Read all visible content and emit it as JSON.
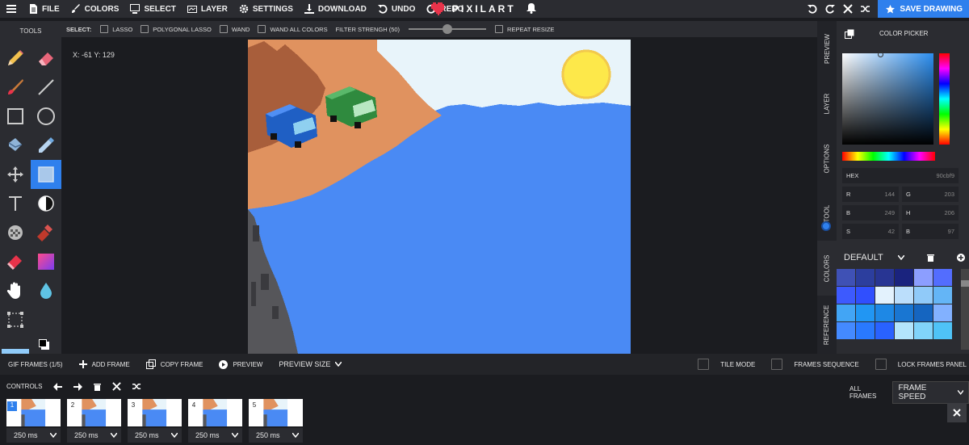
{
  "topbar": {
    "file": "FILE",
    "colors": "COLORS",
    "select": "SELECT",
    "layer": "LAYER",
    "settings": "SETTINGS",
    "download": "DOWNLOAD",
    "undo": "UNDO",
    "redo": "REDO",
    "logo_text": "PIXILART",
    "save": "SAVE DRAWING"
  },
  "tools_title": "TOOLS",
  "selection": {
    "label": "SELECT:",
    "lasso": "LASSO",
    "polygonal_lasso": "POLYGONAL LASSO",
    "wand": "WAND",
    "wand_all_colors": "WAND ALL COLORS",
    "filter_strength": "FILTER STRENGH (50)",
    "filter_value": 50,
    "repeat_resize": "REPEAT RESIZE"
  },
  "coords": "X: -61 Y: 129",
  "side_tabs": [
    "PREVIEW",
    "LAYER",
    "OPTIONS",
    "TOOL",
    "COLORS",
    "REFERENCE"
  ],
  "color_picker": {
    "title": "COLOR PICKER",
    "hex_label": "HEX",
    "hex": "90cbf9",
    "r_label": "R",
    "r": "144",
    "g_label": "G",
    "g": "203",
    "b_label": "B",
    "b": "249",
    "h_label": "H",
    "h": "206",
    "s_label": "S",
    "s": "42",
    "b2_label": "B",
    "b2": "97"
  },
  "palette": {
    "name": "DEFAULT",
    "colors": [
      "#3f51b5",
      "#2c3e9e",
      "#283593",
      "#1a237e",
      "#8c9eff",
      "#536dfe",
      "#3d5afe",
      "#304ffe",
      "#e3f2fd",
      "#bbdefb",
      "#90caf9",
      "#64b5f6",
      "#42a5f5",
      "#2196f3",
      "#1e88e5",
      "#1976d2",
      "#1565c0",
      "#82b1ff",
      "#448aff",
      "#2979ff",
      "#2962ff",
      "#b3e5fc",
      "#81d4fa",
      "#4fc3f7"
    ]
  },
  "frames_bar": {
    "gif_frames": "GIF FRAMES (1/5)",
    "add_frame": "ADD FRAME",
    "copy_frame": "COPY FRAME",
    "preview": "PREVIEW",
    "preview_size": "PREVIEW SIZE",
    "tile_mode": "TILE MODE",
    "frames_sequence": "FRAMES SEQUENCE",
    "lock_frames_panel": "LOCK FRAMES PANEL"
  },
  "controls": {
    "label": "CONTROLS",
    "all_frames": "ALL FRAMES",
    "frame_speed": "FRAME SPEED"
  },
  "frames": [
    {
      "num": "1",
      "ms": "250 ms"
    },
    {
      "num": "2",
      "ms": "250 ms"
    },
    {
      "num": "3",
      "ms": "250 ms"
    },
    {
      "num": "4",
      "ms": "250 ms"
    },
    {
      "num": "5",
      "ms": "250 ms"
    }
  ],
  "colors": {
    "accent": "#2f80ed",
    "heart": "#e8334a",
    "water": "#4a8af4",
    "sand": "#e0925f",
    "sky": "#e8f4fa",
    "sun": "#fde84a"
  }
}
